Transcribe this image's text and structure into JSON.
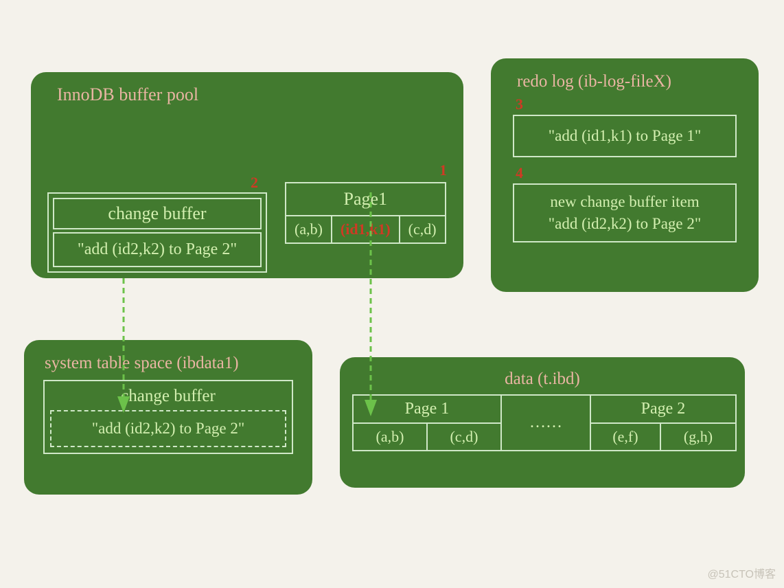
{
  "buffer_pool": {
    "title": "InnoDB buffer pool",
    "step2": "2",
    "step1": "1",
    "change_buffer": {
      "label": "change buffer",
      "entry": "\"add (id2,k2) to Page 2\""
    },
    "page1": {
      "title": "Page1",
      "cells": [
        "(a,b)",
        "(id1,k1)",
        "(c,d)"
      ]
    }
  },
  "redo_log": {
    "title": "redo log (ib-log-fileX)",
    "step3": "3",
    "entry3": "\"add (id1,k1) to Page 1\"",
    "step4": "4",
    "entry4_line1": "new change buffer item",
    "entry4_line2": "\"add (id2,k2) to Page 2\""
  },
  "system_tablespace": {
    "title": "system table space (ibdata1)",
    "change_buffer": {
      "label": "change buffer",
      "entry": "\"add (id2,k2) to Page 2\""
    }
  },
  "data": {
    "title": "data (t.ibd)",
    "page1": {
      "title": "Page 1",
      "cells": [
        "(a,b)",
        "(c,d)"
      ]
    },
    "ellipsis": "……",
    "page2": {
      "title": "Page 2",
      "cells": [
        "(e,f)",
        "(g,h)"
      ]
    }
  },
  "watermark": "@51CTO博客"
}
